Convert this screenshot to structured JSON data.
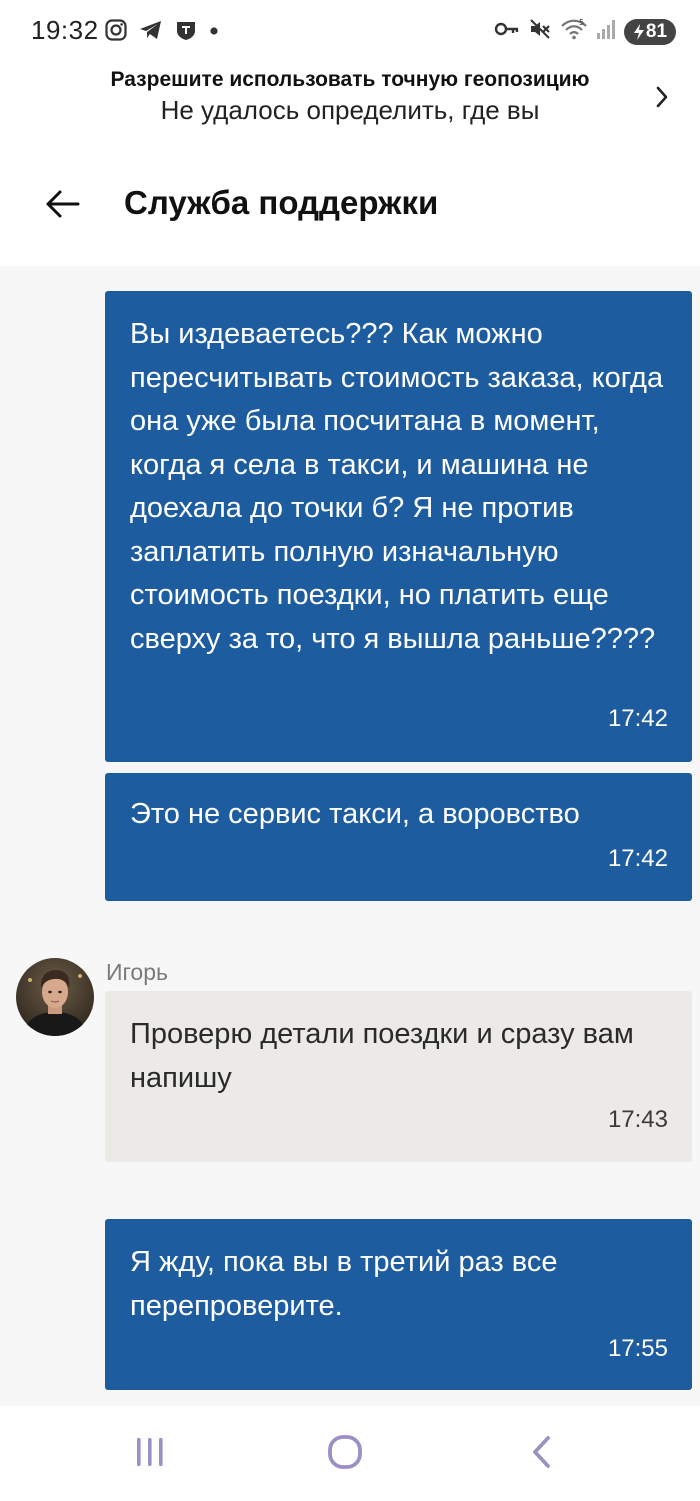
{
  "status_bar": {
    "time": "19:32",
    "battery": "81",
    "icons": [
      "instagram-icon",
      "telegram-icon",
      "shield-app-icon",
      "dot-icon",
      "key-icon",
      "mute-icon",
      "wifi-icon",
      "signal-icon",
      "battery-icon"
    ]
  },
  "geo_banner": {
    "title": "Разрешите использовать точную геопозицию",
    "subtitle": "Не удалось определить, где вы"
  },
  "header": {
    "title": "Служба поддержки"
  },
  "messages": [
    {
      "direction": "outgoing",
      "text": "Вы издеваетесь??? Как можно пересчитывать стоимость заказа, когда она уже была посчитана в момент, когда я села в такси, и машина не доехала до точки б? Я не против заплатить полную изначальную стоимость поездки, но платить еще сверху за то, что я вышла раньше????",
      "time": "17:42"
    },
    {
      "direction": "outgoing",
      "text": "Это не сервис такси, а воровство",
      "time": "17:42"
    },
    {
      "direction": "incoming",
      "sender": "Игорь",
      "text": "Проверю детали поездки и сразу вам напишу",
      "time": "17:43"
    },
    {
      "direction": "outgoing",
      "text": "Я жду, пока вы в третий раз все перепроверите.",
      "time": "17:55"
    }
  ],
  "colors": {
    "outgoing_bubble": "#1e5ca0",
    "incoming_bubble": "#eceae6",
    "chat_background": "#f7f7f7",
    "nav_icons": "#9b8fc4"
  }
}
